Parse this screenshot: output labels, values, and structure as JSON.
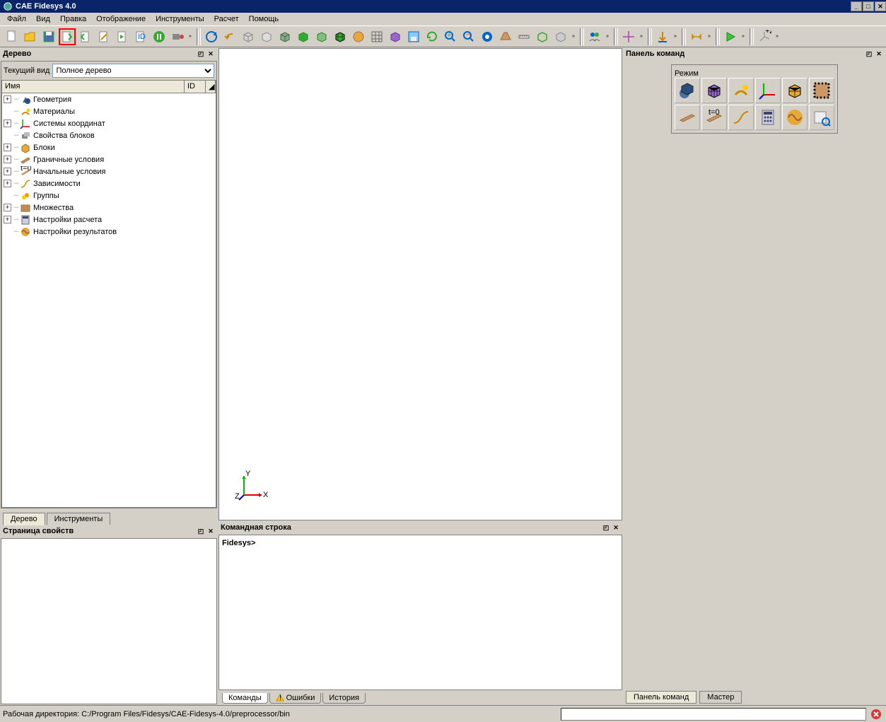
{
  "app_title": "CAE Fidesys 4.0",
  "menu": [
    "Файл",
    "Вид",
    "Правка",
    "Отображение",
    "Инструменты",
    "Расчет",
    "Помощь"
  ],
  "tree_panel": {
    "title": "Дерево",
    "filter_label": "Текущий вид",
    "filter_value": "Полное дерево",
    "col_name": "Имя",
    "col_id": "ID",
    "items": [
      {
        "label": "Геометрия",
        "expand": "+",
        "icon": "geom"
      },
      {
        "label": "Материалы",
        "expand": "",
        "icon": "mat"
      },
      {
        "label": "Системы координат",
        "expand": "+",
        "icon": "coord"
      },
      {
        "label": "Свойства блоков",
        "expand": "",
        "icon": "bprop"
      },
      {
        "label": "Блоки",
        "expand": "+",
        "icon": "block"
      },
      {
        "label": "Граничные условия",
        "expand": "+",
        "icon": "bc"
      },
      {
        "label": "Начальные условия",
        "expand": "+",
        "icon": "ic"
      },
      {
        "label": "Зависимости",
        "expand": "+",
        "icon": "dep"
      },
      {
        "label": "Группы",
        "expand": "",
        "icon": "grp"
      },
      {
        "label": "Множества",
        "expand": "+",
        "icon": "set"
      },
      {
        "label": "Настройки расчета",
        "expand": "+",
        "icon": "calc"
      },
      {
        "label": "Настройки результатов",
        "expand": "",
        "icon": "res"
      }
    ],
    "tabs": [
      "Дерево",
      "Инструменты"
    ]
  },
  "props_panel": {
    "title": "Страница свойств"
  },
  "cmd_line_panel": {
    "title": "Командная строка",
    "prompt": "Fidesys>",
    "tabs": [
      "Команды",
      "Ошибки",
      "История"
    ]
  },
  "cmd_panel": {
    "title": "Панель команд",
    "mode_label": "Режим",
    "bottom_tabs": [
      "Панель команд",
      "Мастер"
    ]
  },
  "axis": {
    "x": "X",
    "y": "Y",
    "z": "Z"
  },
  "statusbar": "Рабочая директория: C:/Program Files/Fidesys/CAE-Fidesys-4.0/preprocessor/bin"
}
